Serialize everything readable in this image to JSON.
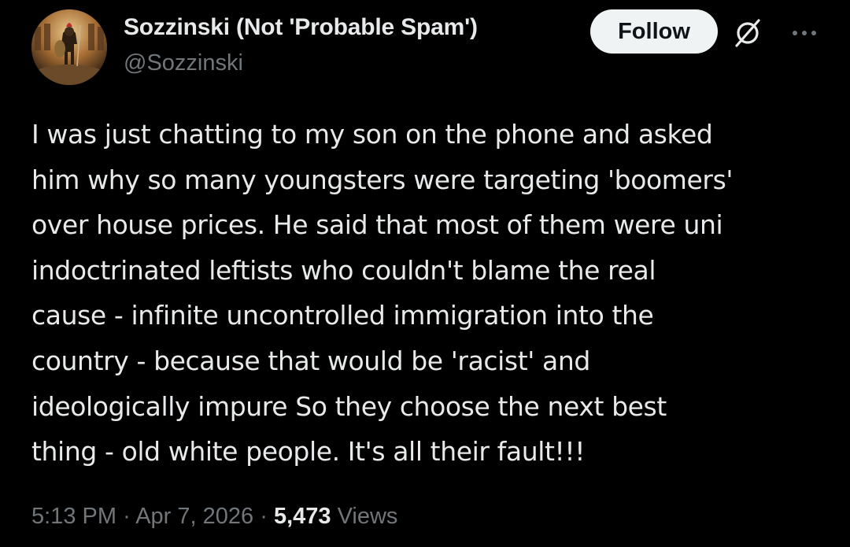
{
  "author": {
    "display_name": "Sozzinski (Not 'Probable Spam')",
    "handle": "@Sozzinski",
    "avatar_icon": "gladiator-avatar"
  },
  "actions": {
    "follow_label": "Follow",
    "grok_icon": "grok-icon",
    "more_icon": "more-icon"
  },
  "tweet": {
    "lines": [
      "I was just chatting to my son on the phone and asked",
      "him why so many youngsters were targeting 'boomers'",
      "over house prices. He said that most of them were uni",
      "indoctrinated leftists who couldn't blame the real",
      "cause - infinite uncontrolled immigration into the",
      "country - because that would be 'racist' and",
      "ideologically impure So they choose the next best",
      "thing - old white people. It's all their fault!!!"
    ]
  },
  "meta": {
    "time": "5:13 PM",
    "separator": "·",
    "date": "Apr 7, 2026",
    "views_count": "5,473",
    "views_label": "Views"
  },
  "colors": {
    "background": "#000000",
    "primary_text": "#e7e9ea",
    "secondary_text": "#71767b",
    "follow_bg": "#eff3f4",
    "follow_text": "#0f1419"
  }
}
